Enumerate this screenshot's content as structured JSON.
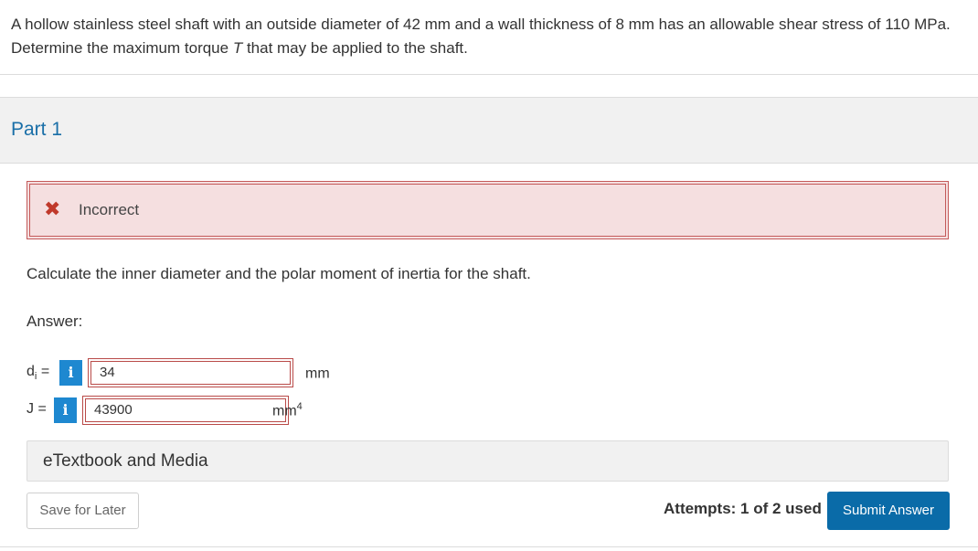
{
  "question": {
    "text": "A hollow stainless steel shaft with an outside diameter of 42 mm and a wall thickness of 8 mm has an allowable shear stress of 110 MPa. Determine the maximum torque T that may be applied to the shaft."
  },
  "part": {
    "title": "Part 1"
  },
  "feedback": {
    "icon": "close-icon",
    "status": "Incorrect",
    "color": "#c0392b"
  },
  "prompt": "Calculate the inner diameter and the polar moment of inertia for the shaft.",
  "answer_label": "Answer:",
  "answers": [
    {
      "var": "d",
      "sub": "i",
      "eq": "=",
      "value": "34",
      "unit": "mm",
      "unit_sup": ""
    },
    {
      "var": "J",
      "sub": "",
      "eq": "=",
      "value": "43900",
      "unit": "mm",
      "unit_sup": "4"
    }
  ],
  "info_label": "i",
  "etextbook": "eTextbook and Media",
  "buttons": {
    "save": "Save for Later",
    "submit": "Submit Answer"
  },
  "attempts": "Attempts: 1 of 2 used",
  "colors": {
    "accent": "#1a6fa8",
    "submit": "#0a6ba8",
    "error_bg": "#f5dfe0",
    "error_border": "#c45a5a",
    "info": "#1e88d0"
  }
}
